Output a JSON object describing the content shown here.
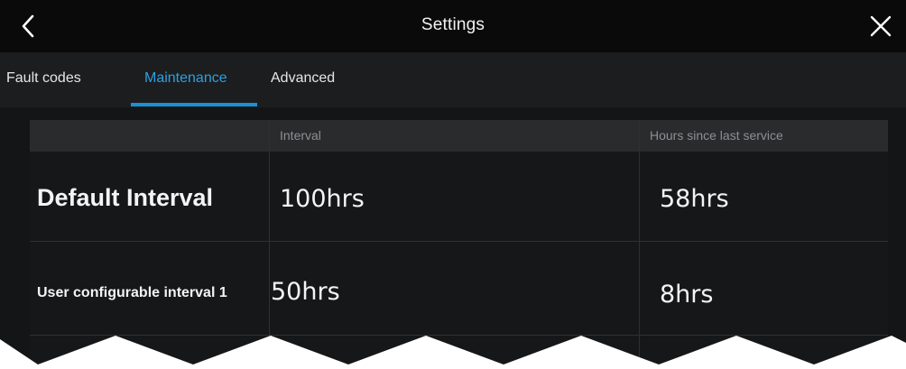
{
  "header": {
    "title": "Settings",
    "back_icon": "chevron-left-icon",
    "close_icon": "close-icon"
  },
  "tabs": [
    {
      "label": "Fault codes",
      "active": false
    },
    {
      "label": "Maintenance",
      "active": true
    },
    {
      "label": "Advanced",
      "active": false
    }
  ],
  "table": {
    "columns": [
      "",
      "Interval",
      "Hours since last service"
    ],
    "rows": [
      {
        "label": "Default Interval",
        "interval": "100hrs",
        "hours_since": "58hrs"
      },
      {
        "label": "User configurable interval 1",
        "interval": "50hrs",
        "hours_since": "8hrs"
      }
    ]
  },
  "colors": {
    "accent": "#1d8fd6",
    "background": "#141516",
    "titlebar": "#0a0a0a",
    "tabbar": "#1c1d1e",
    "table_header": "#2a2b2d"
  }
}
